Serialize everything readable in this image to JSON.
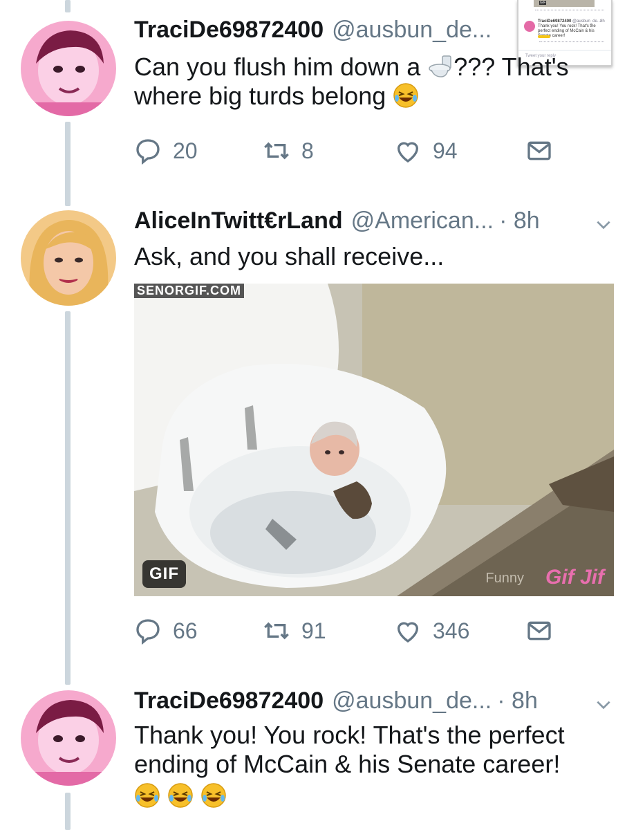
{
  "tweets": [
    {
      "name": "TraciDe69872400",
      "handle": "@ausbun_de...",
      "text_line1_before": "Can you flush him down a",
      "text_line1_after": "??? That's",
      "text_line2": "where big turds belong",
      "replies": "20",
      "retweets": "8",
      "likes": "94"
    },
    {
      "name": "AliceInTwitt€rLand",
      "handle": "@American...",
      "time": "· 8h",
      "text": "Ask, and you shall receive...",
      "media_badge": "GIF",
      "media_watermark_top": "SENORGIF.COM",
      "media_watermark_bottom": "Gif Jif",
      "media_watermark_funny": "Funny",
      "replies": "66",
      "retweets": "91",
      "likes": "346"
    },
    {
      "name": "TraciDe69872400",
      "handle": "@ausbun_de...",
      "time": "· 8h",
      "text_line1": "Thank you! You rock! That's the perfect",
      "text_line2": "ending of McCain & his Senate career!"
    }
  ],
  "thumbnail": {
    "badge": "GIF",
    "name": "TraciDe69872400",
    "handle": "@ausbun_de...",
    "time": "8h",
    "text": "Thank you! You rock! That's the perfect ending of McCain & his Senate career!",
    "reply_placeholder": "Tweet your reply"
  },
  "colors": {
    "text": "#14171a",
    "muted": "#657786",
    "thread_line": "#ccd6dd",
    "watermark_pink": "#e86fae"
  },
  "icons": [
    "reply-icon",
    "retweet-icon",
    "like-icon",
    "direct-message-icon",
    "chevron-down-icon",
    "toilet-emoji-icon",
    "laughing-emoji-icon"
  ]
}
